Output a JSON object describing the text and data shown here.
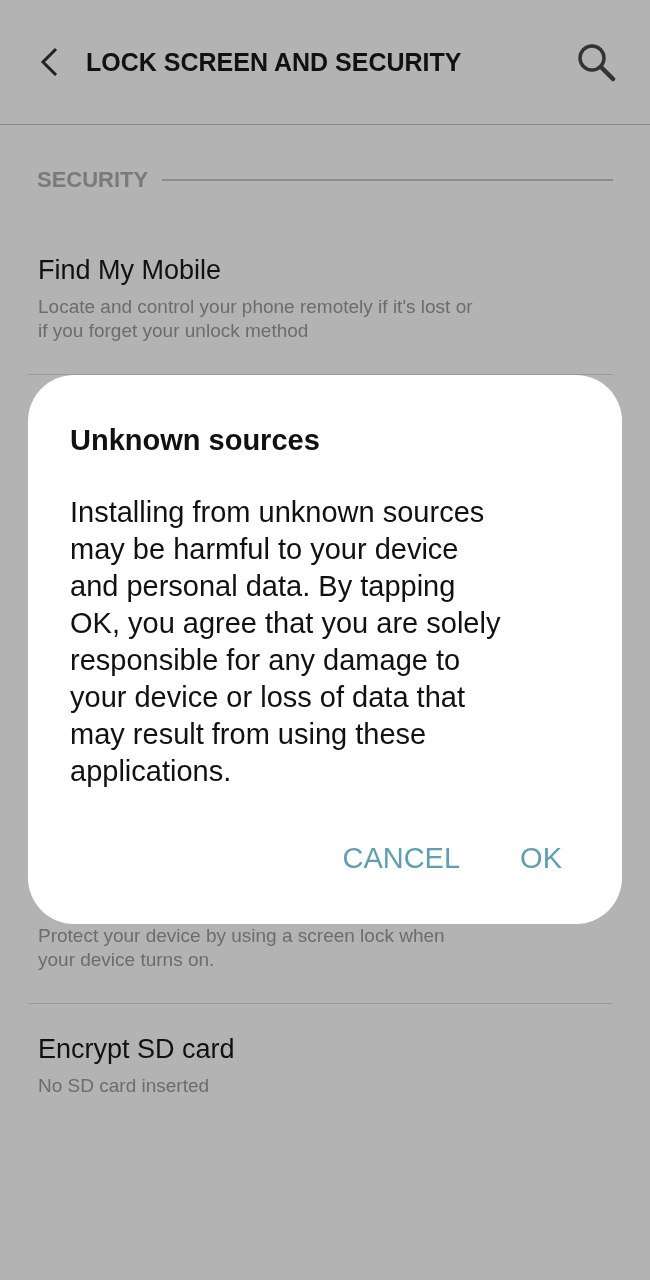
{
  "header": {
    "title": "LOCK SCREEN AND SECURITY"
  },
  "section": {
    "title": "SECURITY"
  },
  "items": [
    {
      "kind": "full",
      "title": "Find My Mobile",
      "subtitle": "Locate and control your phone remotely if it's lost or if you forget your unlock method"
    },
    {
      "kind": "covered",
      "subtitle": "Protect your device by using a screen lock when your device turns on."
    },
    {
      "kind": "full",
      "title": "Encrypt SD card",
      "subtitle": "No SD card inserted"
    }
  ],
  "dialog": {
    "title": "Unknown sources",
    "message": "Installing from unknown sources may be harmful to your device and personal data. By tapping OK, you agree that you are solely responsible for any damage to your device or loss of data that may result from using these applications.",
    "buttons": [
      "CANCEL",
      "OK"
    ]
  }
}
